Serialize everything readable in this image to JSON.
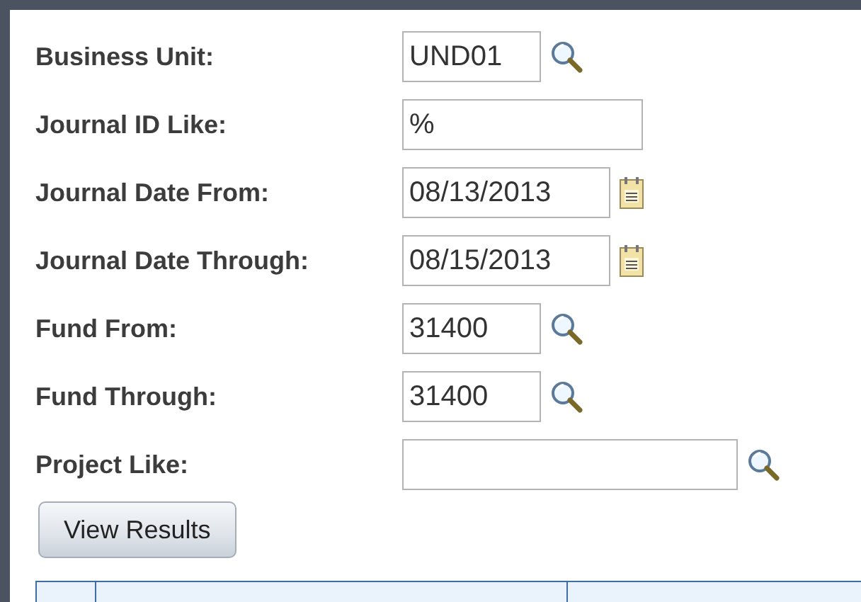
{
  "fields": [
    {
      "label": "Business Unit:",
      "value": "UND01",
      "kind": "lookup"
    },
    {
      "label": "Journal ID Like:",
      "value": "%",
      "kind": "plain"
    },
    {
      "label": "Journal Date From:",
      "value": "08/13/2013",
      "kind": "date"
    },
    {
      "label": "Journal Date Through:",
      "value": "08/15/2013",
      "kind": "date"
    },
    {
      "label": "Fund From:",
      "value": "31400",
      "kind": "lookup"
    },
    {
      "label": "Fund Through:",
      "value": "31400",
      "kind": "lookup"
    },
    {
      "label": "Project Like:",
      "kind": "lookup"
    }
  ],
  "button": "View Results"
}
